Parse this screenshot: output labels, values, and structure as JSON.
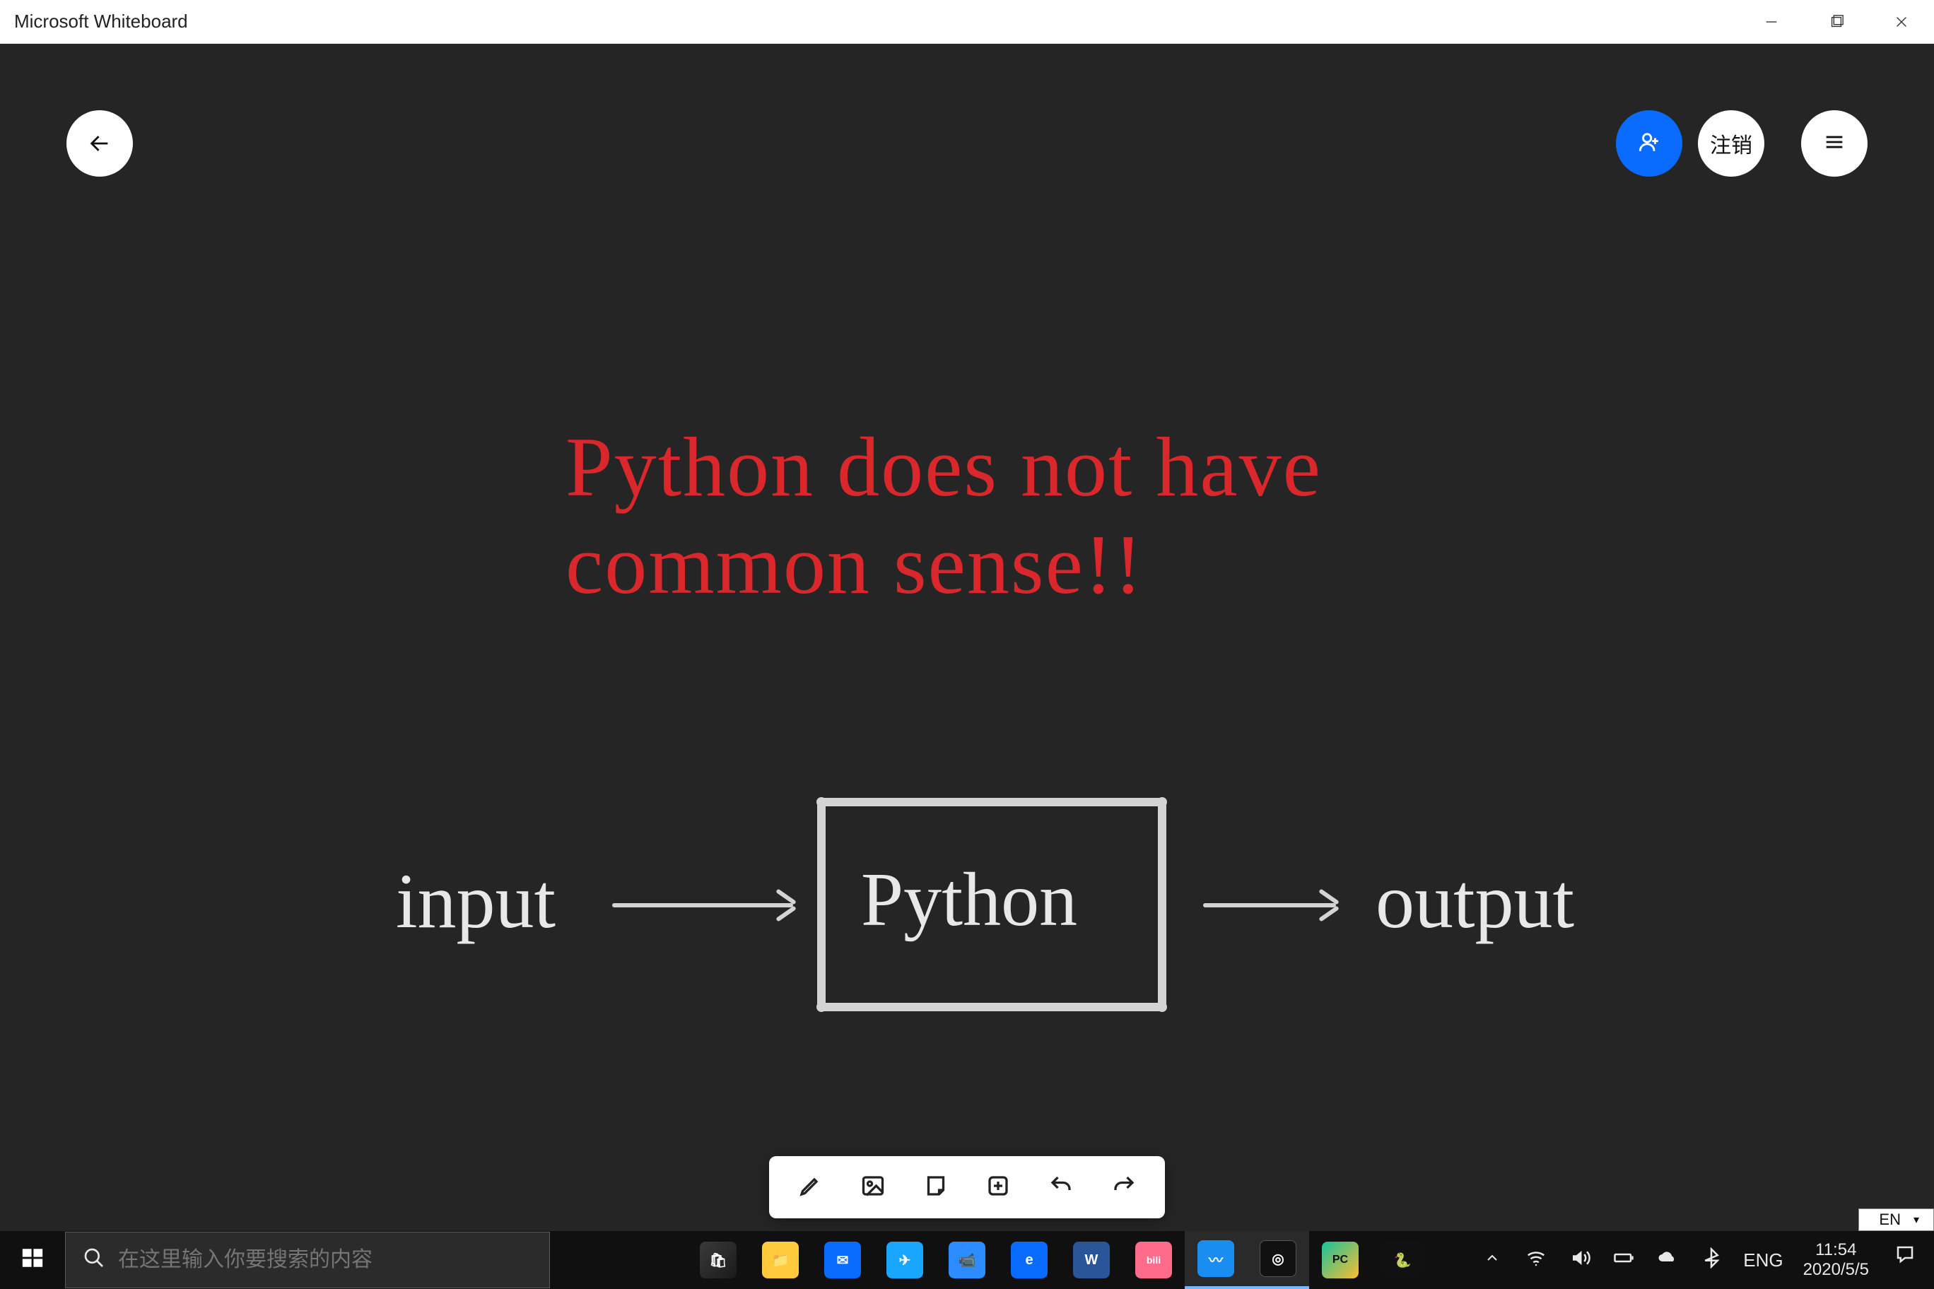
{
  "window": {
    "title": "Microsoft Whiteboard"
  },
  "toolbar_top": {
    "undo_label": "注销"
  },
  "canvas": {
    "headline": "Python does not have\ncommon sense!!",
    "input_label": "input",
    "box_label": "Python",
    "output_label": "output"
  },
  "ime": {
    "lang": "EN",
    "caret": "▾"
  },
  "taskbar": {
    "search_placeholder": "在这里输入你要搜索的内容",
    "tray": {
      "ime_lang": "ENG",
      "time": "11:54",
      "date": "2020/5/5"
    }
  },
  "colors": {
    "canvas_bg": "#252525",
    "ink_red": "#d9272b",
    "ink_white": "#e8e8e8",
    "accent": "#0a6cff"
  }
}
